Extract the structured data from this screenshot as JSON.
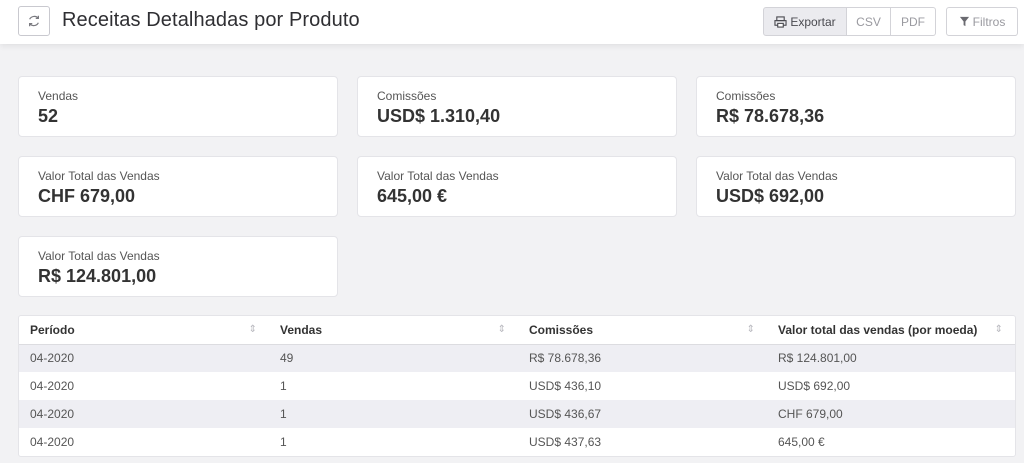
{
  "header": {
    "title": "Receitas Detalhadas por Produto",
    "export_label": "Exportar",
    "csv_label": "CSV",
    "pdf_label": "PDF",
    "filter_label": "Filtros"
  },
  "cards": [
    {
      "label": "Vendas",
      "value": "52"
    },
    {
      "label": "Comissões",
      "value": "USD$ 1.310,40"
    },
    {
      "label": "Comissões",
      "value": "R$ 78.678,36"
    },
    {
      "label": "Valor Total das Vendas",
      "value": "CHF 679,00"
    },
    {
      "label": "Valor Total das Vendas",
      "value": "645,00 €"
    },
    {
      "label": "Valor Total das Vendas",
      "value": "USD$ 692,00"
    },
    {
      "label": "Valor Total das Vendas",
      "value": "R$ 124.801,00"
    }
  ],
  "table": {
    "headers": [
      "Período",
      "Vendas",
      "Comissões",
      "Valor total das vendas (por moeda)"
    ],
    "rows": [
      [
        "04-2020",
        "49",
        "R$ 78.678,36",
        "R$ 124.801,00"
      ],
      [
        "04-2020",
        "1",
        "USD$ 436,10",
        "USD$ 692,00"
      ],
      [
        "04-2020",
        "1",
        "USD$ 436,67",
        "CHF 679,00"
      ],
      [
        "04-2020",
        "1",
        "USD$ 437,63",
        "645,00 €"
      ]
    ]
  }
}
